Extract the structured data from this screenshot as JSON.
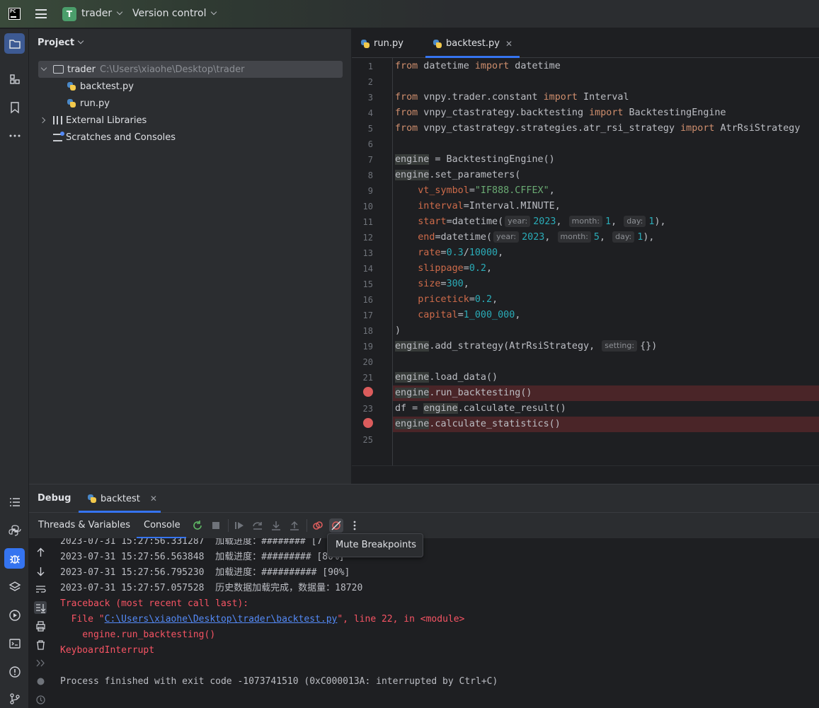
{
  "titlebar": {
    "logo": "PC",
    "project_badge": "T",
    "project_name": "trader",
    "vcs_label": "Version control"
  },
  "project_panel": {
    "header": "Project",
    "root": {
      "name": "trader",
      "path": "C:\\Users\\xiaohe\\Desktop\\trader"
    },
    "files": [
      "backtest.py",
      "run.py"
    ],
    "external_libraries": "External Libraries",
    "scratches": "Scratches and Consoles"
  },
  "editor": {
    "tabs": [
      {
        "label": "run.py",
        "active": false
      },
      {
        "label": "backtest.py",
        "active": true
      }
    ],
    "line_numbers": [
      "1",
      "2",
      "3",
      "4",
      "5",
      "6",
      "7",
      "8",
      "9",
      "10",
      "11",
      "12",
      "13",
      "14",
      "15",
      "16",
      "17",
      "18",
      "19",
      "20",
      "21",
      "22",
      "23",
      "24",
      "25"
    ],
    "breakpoint_lines": [
      22,
      24
    ],
    "code": {
      "l1": [
        "from",
        " datetime ",
        "import",
        " datetime"
      ],
      "l3": [
        "from",
        " vnpy.trader.constant ",
        "import",
        " Interval"
      ],
      "l4": [
        "from",
        " vnpy_ctastrategy.backtesting ",
        "import",
        " BacktestingEngine"
      ],
      "l5": [
        "from",
        " vnpy_ctastrategy.strategies.atr_rsi_strategy ",
        "import",
        " AtrRsiStrategy"
      ],
      "l7": [
        "engine",
        " = BacktestingEngine()"
      ],
      "l8": [
        "engine",
        ".set_parameters("
      ],
      "l9": [
        "    ",
        "vt_symbol",
        "=",
        "\"IF888.CFFEX\"",
        ","
      ],
      "l10": [
        "    ",
        "interval",
        "=Interval.MINUTE,"
      ],
      "l11": [
        "    ",
        "start",
        "=datetime(",
        "year:",
        "2023",
        ", ",
        "month:",
        "1",
        ", ",
        "day:",
        "1",
        "),"
      ],
      "l12": [
        "    ",
        "end",
        "=datetime(",
        "year:",
        "2023",
        ", ",
        "month:",
        "5",
        ", ",
        "day:",
        "1",
        "),"
      ],
      "l13": [
        "    ",
        "rate",
        "=",
        "0.3",
        "/",
        "10000",
        ","
      ],
      "l14": [
        "    ",
        "slippage",
        "=",
        "0.2",
        ","
      ],
      "l15": [
        "    ",
        "size",
        "=",
        "300",
        ","
      ],
      "l16": [
        "    ",
        "pricetick",
        "=",
        "0.2",
        ","
      ],
      "l17": [
        "    ",
        "capital",
        "=",
        "1_000_000",
        ","
      ],
      "l18": [
        ")"
      ],
      "l19": [
        "engine",
        ".add_strategy(AtrRsiStrategy, ",
        "setting:",
        "{})"
      ],
      "l21": [
        "engine",
        ".load_data()"
      ],
      "l22": [
        "engine",
        ".run_backtesting()"
      ],
      "l23": [
        "df = ",
        "engine",
        ".calculate_result()"
      ],
      "l24": [
        "engine",
        ".calculate_statistics()"
      ]
    }
  },
  "debug": {
    "title": "Debug",
    "session_tab": "backtest",
    "toolbar_tabs": [
      "Threads & Variables",
      "Console"
    ],
    "tooltip": "Mute Breakpoints",
    "console_lines": [
      {
        "text": "2023-07-31 15:27:56.331287  加载进度：######## [7",
        "type": "normal"
      },
      {
        "text": "2023-07-31 15:27:56.563848  加载进度：######### [80%]",
        "type": "normal"
      },
      {
        "text": "2023-07-31 15:27:56.795230  加载进度：########## [90%]",
        "type": "normal"
      },
      {
        "text": "2023-07-31 15:27:57.057528  历史数据加载完成，数据量：18720",
        "type": "normal"
      },
      {
        "text": "Traceback (most recent call last):",
        "type": "error"
      },
      {
        "text_pre": "  File \"",
        "link": "C:\\Users\\xiaohe\\Desktop\\trader\\backtest.py",
        "text_post": "\", line 22, in <module>",
        "type": "error-link"
      },
      {
        "text": "    engine.run_backtesting()",
        "type": "error"
      },
      {
        "text": "KeyboardInterrupt",
        "type": "error"
      },
      {
        "text": "",
        "type": "normal"
      },
      {
        "text": "Process finished with exit code -1073741510 (0xC000013A: interrupted by Ctrl+C)",
        "type": "normal"
      }
    ]
  },
  "colors": {
    "accent": "#3574f0",
    "breakpoint": "#db5c5c",
    "error_text": "#f75464",
    "keyword": "#cf8e6d",
    "string": "#6aab73",
    "number": "#2aacb8"
  }
}
